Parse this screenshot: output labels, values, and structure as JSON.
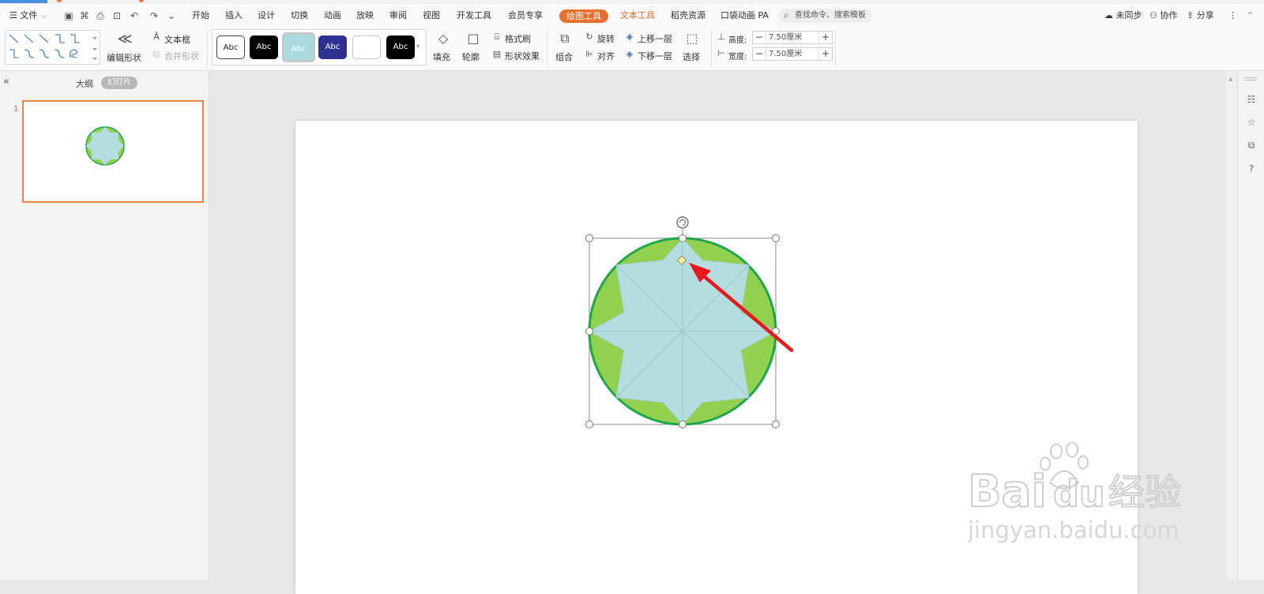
{
  "menu": {
    "file_label": "文件",
    "tabs": [
      "开始",
      "插入",
      "设计",
      "切换",
      "动画",
      "放映",
      "审阅",
      "视图",
      "开发工具",
      "会员专享"
    ],
    "drawing_tools": "绘图工具",
    "text_tools": "文本工具",
    "resources": "稻壳资源",
    "pocket_anim": "口袋动画 PA",
    "search_placeholder": "查找命令、搜索模板",
    "sync": "未同步",
    "collaborate": "协作",
    "share": "分享"
  },
  "ribbon": {
    "edit_shape": "编辑形状",
    "text_box": "文本框",
    "merge_shape": "合并形状",
    "style_sample": "Abc",
    "fill": "填充",
    "outline": "轮廓",
    "format_painter": "格式刷",
    "shape_effects": "形状效果",
    "group": "组合",
    "rotate": "旋转",
    "align": "对齐",
    "bring_forward": "上移一层",
    "send_backward": "下移一层",
    "select": "选择",
    "height_label": "高度:",
    "height_value": "7.50厘米",
    "width_label": "宽度:",
    "width_value": "7.50厘米"
  },
  "left_panel": {
    "outline_tab": "大纲",
    "slides_tab": "幻灯片",
    "slide_number": "1"
  },
  "colors": {
    "accent": "#e86f2d",
    "shape_circle_fill": "#92d050",
    "shape_circle_stroke": "#1fa64a",
    "shape_star_fill": "#b4dde0",
    "arrow": "#e8191c",
    "adjust_handle": "#f7f08a"
  },
  "watermark": {
    "brand": "Bai",
    "brand_suffix": "du",
    "cn": "经验",
    "url": "jingyan.baidu.com"
  }
}
